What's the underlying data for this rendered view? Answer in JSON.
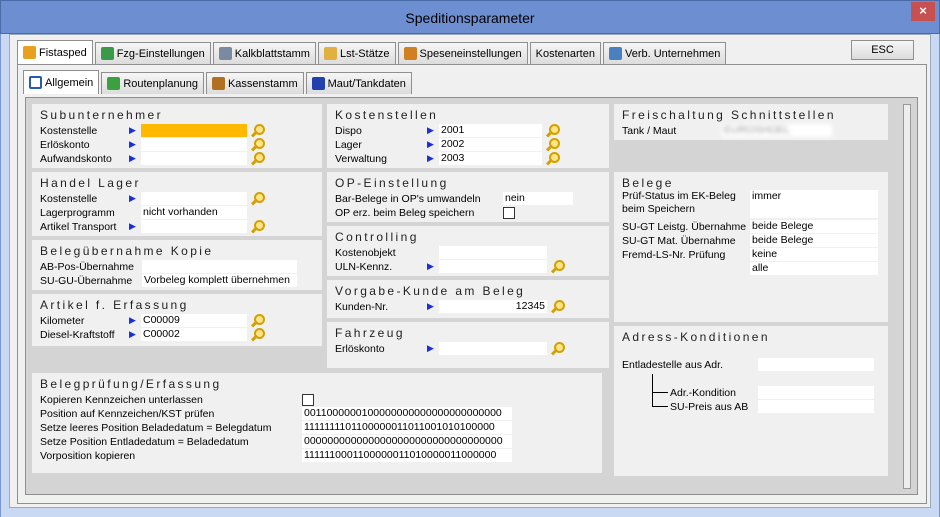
{
  "window": {
    "title": "Speditionsparameter",
    "close_label": "×"
  },
  "main_tabs": [
    {
      "label": "Fistasped",
      "color": "#e8a020"
    },
    {
      "label": "Fzg-Einstellungen",
      "color": "#3a9a4a"
    },
    {
      "label": "Kalkblattstamm",
      "color": "#7a8aa0"
    },
    {
      "label": "Lst-Stätze",
      "color": "#e0b040"
    },
    {
      "label": "Speseneinstellungen",
      "color": "#d08020"
    },
    {
      "label": "Kostenarten",
      "color": ""
    },
    {
      "label": "Verb. Unternehmen",
      "color": "#4a80c0"
    }
  ],
  "esc_label": "ESC",
  "sub_tabs": [
    {
      "label": "Allgemein",
      "color": "#2a5ab0"
    },
    {
      "label": "Routenplanung",
      "color": "#3aa040"
    },
    {
      "label": "Kassenstamm",
      "color": "#b07020"
    },
    {
      "label": "Maut/Tankdaten",
      "color": "#2040b0"
    }
  ],
  "subunternehmer": {
    "title": "Subunternehmer",
    "rows": [
      {
        "label": "Kostenstelle",
        "value": ""
      },
      {
        "label": "Erlöskonto",
        "value": ""
      },
      {
        "label": "Aufwandskonto",
        "value": ""
      }
    ]
  },
  "handel_lager": {
    "title": "Handel Lager",
    "rows": [
      {
        "label": "Kostenstelle",
        "value": ""
      },
      {
        "label": "Lagerprogramm",
        "value": "nicht vorhanden"
      },
      {
        "label": "Artikel Transport",
        "value": ""
      }
    ]
  },
  "beleguebernahme": {
    "title": "Belegübernahme Kopie",
    "rows": [
      {
        "label": "AB-Pos-Übernahme",
        "value": ""
      },
      {
        "label": "SU-GU-Übernahme",
        "value": "Vorbeleg komplett übernehmen"
      }
    ]
  },
  "artikel_erfassung": {
    "title": "Artikel f. Erfassung",
    "rows": [
      {
        "label": "Kilometer",
        "value": "C00009"
      },
      {
        "label": "Diesel-Kraftstoff",
        "value": "C00002"
      }
    ]
  },
  "belegpruefung": {
    "title": "Belegprüfung/Erfassung",
    "rows": [
      {
        "label": "Kopieren Kennzeichen unterlassen",
        "value": ""
      },
      {
        "label": "Position auf Kennzeichen/KST prüfen",
        "value": "0011000000100000000000000000000000"
      },
      {
        "label": "Setze leeres Position Beladedatum = Belegdatum",
        "value": "1111111101100000011011001010100000"
      },
      {
        "label": "Setze Position Entladedatum = Beladedatum",
        "value": "0000000000000000000000000000000000"
      },
      {
        "label": "Vorposition kopieren",
        "value": "1111110001100000011010000011000000"
      }
    ]
  },
  "kostenstellen": {
    "title": "Kostenstellen",
    "rows": [
      {
        "label": "Dispo",
        "value": "2001"
      },
      {
        "label": "Lager",
        "value": "2002"
      },
      {
        "label": "Verwaltung",
        "value": "2003"
      }
    ]
  },
  "op_einstellung": {
    "title": "OP-Einstellung",
    "rows": [
      {
        "label": "Bar-Belege in OP's umwandeln",
        "value": "nein"
      },
      {
        "label": "OP erz. beim Beleg speichern",
        "value": ""
      }
    ]
  },
  "controlling": {
    "title": "Controlling",
    "rows": [
      {
        "label": "Kostenobjekt",
        "value": ""
      },
      {
        "label": "ULN-Kennz.",
        "value": ""
      }
    ]
  },
  "vorgabe_kunde": {
    "title": "Vorgabe-Kunde am Beleg",
    "rows": [
      {
        "label": "Kunden-Nr.",
        "value": "12345"
      }
    ]
  },
  "fahrzeug": {
    "title": "Fahrzeug",
    "rows": [
      {
        "label": "Erlöskonto",
        "value": ""
      }
    ]
  },
  "schnittstellen": {
    "title": "Freischaltung Schnittstellen",
    "rows": [
      {
        "label": "Tank / Maut",
        "value": "EUROSHOEL"
      }
    ]
  },
  "belege": {
    "title": "Belege",
    "rows": [
      {
        "label": "Prüf-Status im EK-Beleg beim Speichern",
        "value": "immer"
      },
      {
        "label": "SU-GT Leistg. Übernahme",
        "value": "beide Belege"
      },
      {
        "label": "SU-GT Mat. Übernahme",
        "value": "beide Belege"
      },
      {
        "label": "Fremd-LS-Nr. Prüfung",
        "value": "keine"
      },
      {
        "label": "",
        "value": "alle"
      }
    ]
  },
  "adress_konditionen": {
    "title": "Adress-Konditionen",
    "rows": [
      {
        "label": "Entladestelle aus Adr.",
        "value": ""
      },
      {
        "label": "Adr.-Kondition",
        "value": ""
      },
      {
        "label": "SU-Preis aus AB",
        "value": ""
      }
    ]
  }
}
